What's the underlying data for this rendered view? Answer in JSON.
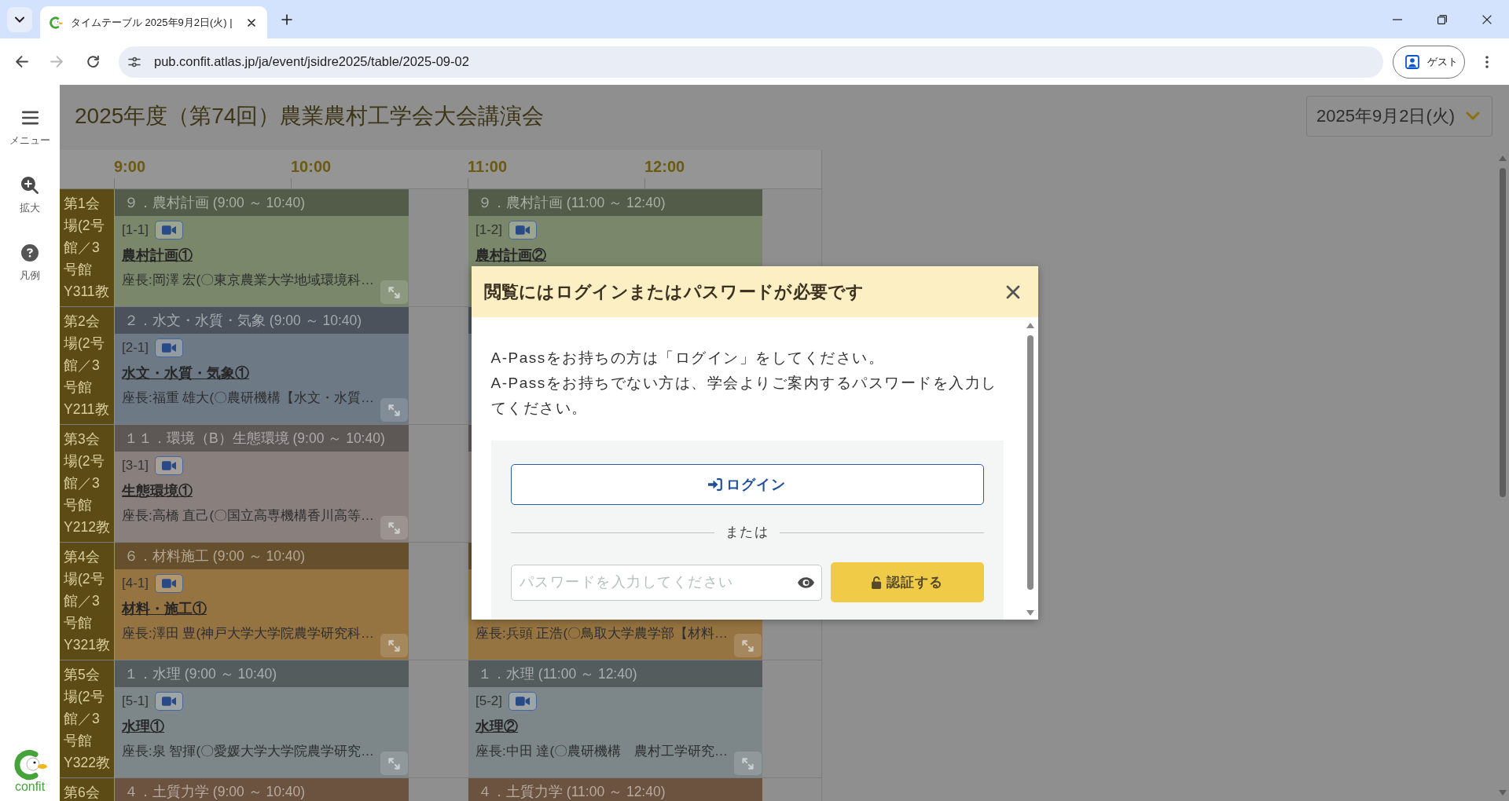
{
  "browser": {
    "tab_title": "タイムテーブル 2025年9月2日(火) |",
    "forward_disabled": true,
    "url": "pub.confit.atlas.jp/ja/event/jsidre2025/table/2025-09-02",
    "profile": "ゲスト"
  },
  "sidebar": {
    "items": [
      {
        "kind": "menu",
        "label": "メニュー"
      },
      {
        "kind": "zoom",
        "label": "拡大"
      },
      {
        "kind": "legend",
        "label": "凡例"
      }
    ],
    "logo": "confit"
  },
  "page": {
    "title": "2025年度（第74回）農業農村工学会大会講演会",
    "date": "2025年9月2日(火)"
  },
  "timetable": {
    "times": [
      "9:00",
      "10:00",
      "11:00",
      "12:00"
    ],
    "rows": [
      {
        "room": "第1会場(2号館／3号館Y311教",
        "sessions": [
          {
            "color": "#535c49",
            "header": "９．農村計画 (9:00 ～ 10:40)",
            "code": "[1-1]",
            "title": "農村計画①",
            "chair": "座長:岡澤 宏(〇東京農業大学地域環境科…"
          },
          {
            "color": "#535c49",
            "header": "９．農村計画 (11:00 ～ 12:40)",
            "code": "[1-2]",
            "title": "農村計画②"
          }
        ]
      },
      {
        "room": "第2会場(2号館／3号館Y211教",
        "sessions": [
          {
            "color": "#4b525b",
            "header": "２．水文・水質・気象 (9:00 ～ 10:40)",
            "code": "[2-1]",
            "title": "水文・水質・気象①",
            "chair": "座長:福重 雄大(〇農研機構【水文・水質…"
          },
          {
            "color": "#4b525b"
          }
        ]
      },
      {
        "room": "第3会場(2号館／3号館Y212教",
        "sessions": [
          {
            "color": "#5d5755",
            "header": "１１．環境（B）生態環境 (9:00 ～ 10:40)",
            "code": "[3-1]",
            "title": "生態環境①",
            "chair": "座長:高橋 直己(〇国立高専機構香川高等…"
          },
          {
            "color": "#5d5755"
          }
        ]
      },
      {
        "room": "第4会場(2号館／3号館Y321教",
        "sessions": [
          {
            "color": "#664f2c",
            "header": "６．材料施工 (9:00 ～ 10:40)",
            "code": "[4-1]",
            "title": "材料・施工①",
            "chair": "座長:澤田 豊(神戸大学大学院農学研究科…"
          },
          {
            "color": "#664f2c",
            "chair": "座長:兵頭 正浩(〇鳥取大学農学部【材料…"
          }
        ]
      },
      {
        "room": "第5会場(2号館／3号館Y322教",
        "sessions": [
          {
            "color": "#555c5e",
            "header": "１．水理 (9:00 ～ 10:40)",
            "code": "[5-1]",
            "title": "水理①",
            "chair": "座長:泉 智揮(〇愛媛大学大学院農学研究…"
          },
          {
            "color": "#555c5e",
            "header": "１．水理 (11:00 ～ 12:40)",
            "code": "[5-2]",
            "title": "水理②",
            "chair": "座長:中田 達(〇農研機構　農村工学研究…"
          }
        ]
      },
      {
        "room": "第6会",
        "sessions": [
          {
            "color": "#6c5340",
            "header": "４．土質力学 (9:00 ～ 10:40)"
          },
          {
            "color": "#6c5340",
            "header": "４．土質力学 (11:00 ～ 12:40)"
          }
        ]
      }
    ]
  },
  "modal": {
    "title": "閲覧にはログインまたはパスワードが必要です",
    "message_lines": [
      "A-Passをお持ちの方は「ログイン」をしてください。",
      "A-Passをお持ちでない方は、学会よりご案内するパスワードを入力してください。"
    ],
    "login_button": "ログイン",
    "divider": "または",
    "password_field": {
      "placeholder": "パスワードを入力してください"
    },
    "submit_button": "認証する"
  }
}
